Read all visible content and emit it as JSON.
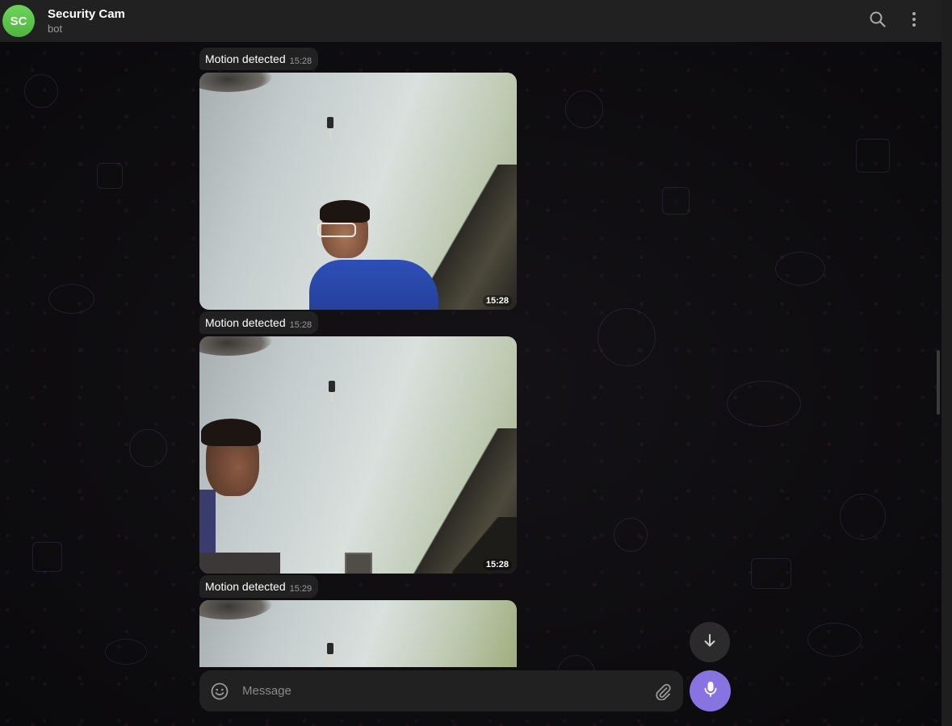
{
  "header": {
    "avatar_initials": "SC",
    "title": "Security Cam",
    "subtitle": "bot",
    "search_icon": "search-icon",
    "menu_icon": "more-vertical-icon"
  },
  "messages": [
    {
      "caption": "Motion detected",
      "caption_time": "15:28",
      "photo_time": "15:28"
    },
    {
      "caption": "Motion detected",
      "caption_time": "15:28",
      "photo_time": "15:28"
    },
    {
      "caption": "Motion detected",
      "caption_time": "15:29"
    }
  ],
  "composer": {
    "placeholder": "Message",
    "emoji_icon": "emoji-icon",
    "attach_icon": "paperclip-icon",
    "mic_icon": "microphone-icon"
  },
  "scroll_down_icon": "arrow-down-icon",
  "colors": {
    "header_bg": "#212121",
    "accent": "#8774e1",
    "avatar": "#5cc44a",
    "bubble_bg": "#212121"
  }
}
